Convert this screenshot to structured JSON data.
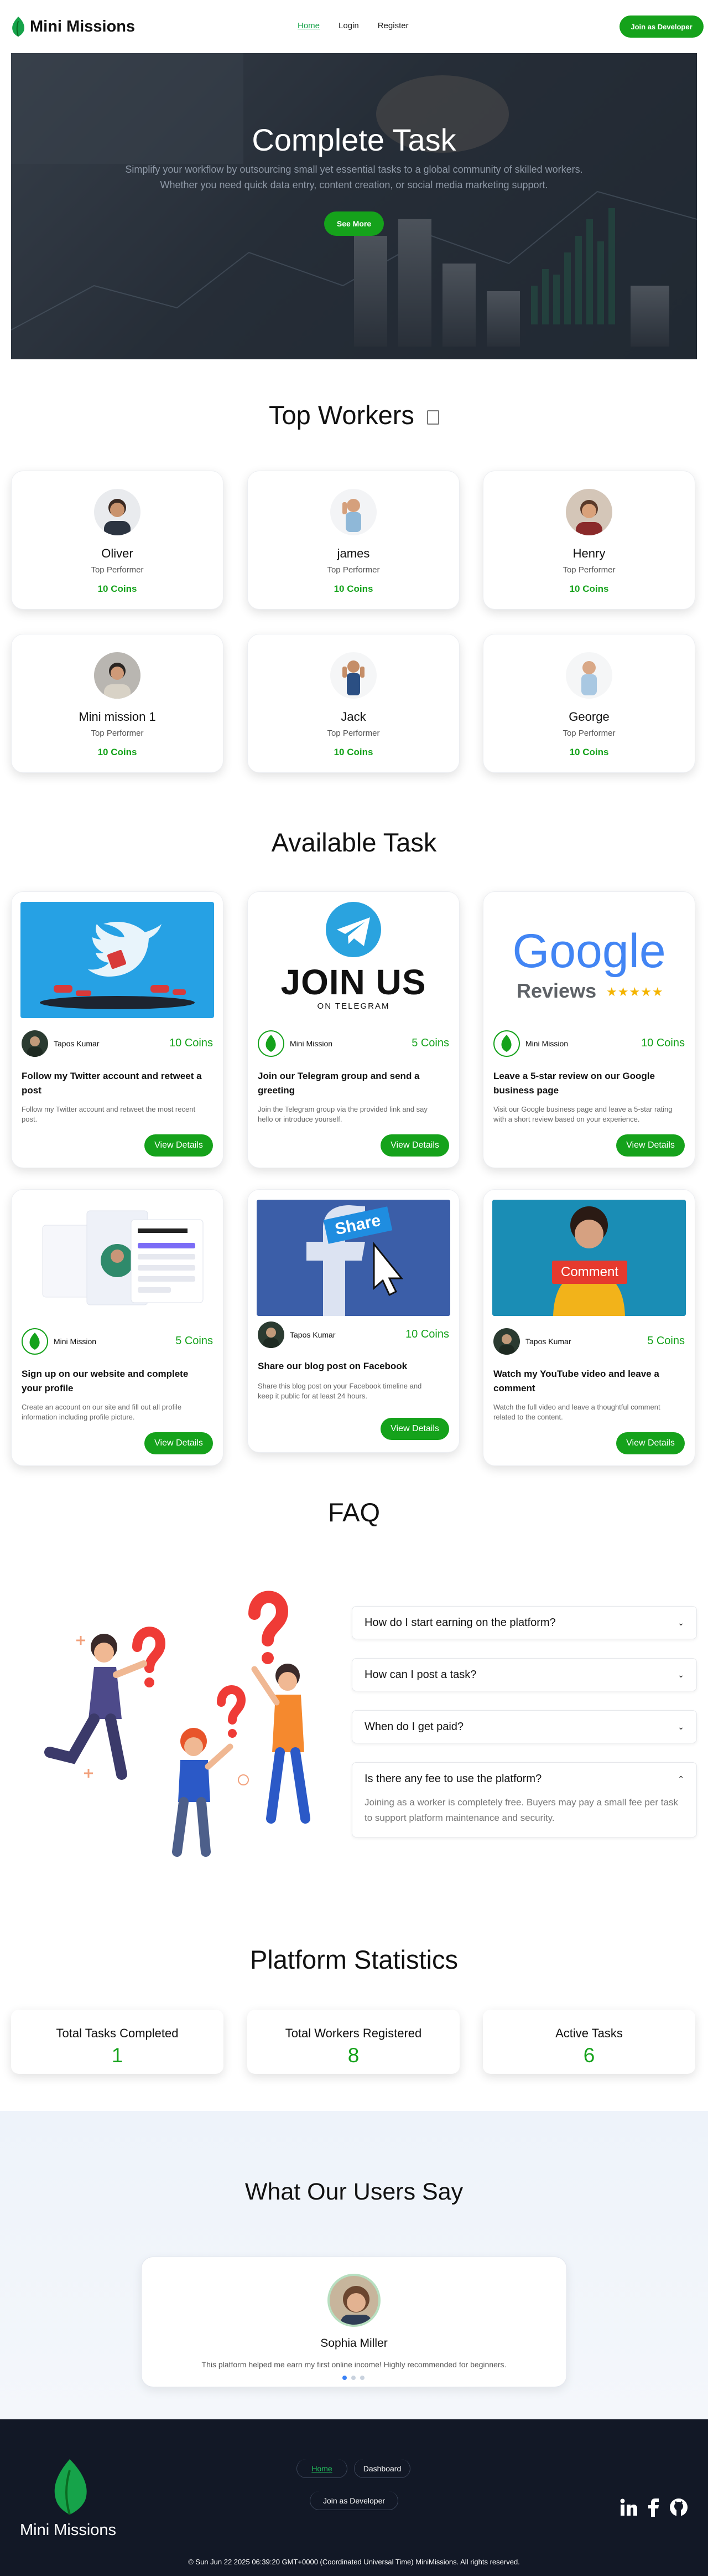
{
  "nav": {
    "brand": "Mini Missions",
    "links": [
      "Home",
      "Login",
      "Register"
    ],
    "join_button": "Join as Developer"
  },
  "hero": {
    "title": "Complete Task",
    "subtitle": "Simplify your workflow by outsourcing small yet essential tasks to a global community of skilled workers. Whether you need quick data entry, content creation, or social media marketing support.",
    "button": "See More"
  },
  "top_workers": {
    "title": "Top Workers",
    "items": [
      {
        "name": "Oliver",
        "role": "Top Performer",
        "coins": "10 Coins"
      },
      {
        "name": "james",
        "role": "Top Performer",
        "coins": "10 Coins"
      },
      {
        "name": "Henry",
        "role": "Top Performer",
        "coins": "10 Coins"
      },
      {
        "name": "Mini mission 1",
        "role": "Top Performer",
        "coins": "10 Coins"
      },
      {
        "name": "Jack",
        "role": "Top Performer",
        "coins": "10 Coins"
      },
      {
        "name": "George",
        "role": "Top Performer",
        "coins": "10 Coins"
      }
    ]
  },
  "tasks": {
    "title": "Available Task",
    "button_label": "View Details",
    "items": [
      {
        "poster": "Tapos Kumar",
        "coins": "10 Coins",
        "title": "Follow my Twitter account and retweet a post",
        "desc": "Follow my Twitter account and retweet the most recent post.",
        "image": "twitter-promo-image"
      },
      {
        "poster": "Mini Mission",
        "coins": "5 Coins",
        "title": "Join our Telegram group and send a greeting",
        "desc": "Join the Telegram group via the provided link and say hello or introduce yourself.",
        "image": "telegram-join-image",
        "image_text": "JOIN US",
        "image_sub": "ON TELEGRAM"
      },
      {
        "poster": "Mini Mission",
        "coins": "10 Coins",
        "title": "Leave a 5-star review on our Google business page",
        "desc": "Visit our Google business page and leave a 5-star rating with a short review based on your experience.",
        "image": "google-reviews-image",
        "image_text": "Google",
        "image_sub": "Reviews"
      },
      {
        "poster": "Mini Mission",
        "coins": "5 Coins",
        "title": "Sign up on our website and complete your profile",
        "desc": "Create an account on our site and fill out all profile information including profile picture.",
        "image": "profile-signup-image"
      },
      {
        "poster": "Tapos Kumar",
        "coins": "10 Coins",
        "title": "Share our blog post on Facebook",
        "desc": "Share this blog post on your Facebook timeline and keep it public for at least 24 hours.",
        "image": "facebook-share-image",
        "image_text": "Share"
      },
      {
        "poster": "Tapos Kumar",
        "coins": "5 Coins",
        "title": "Watch my YouTube video and leave a comment",
        "desc": "Watch the full video and leave a thoughtful comment related to the content.",
        "image": "youtube-comment-image",
        "image_text": "Comment"
      }
    ]
  },
  "faq": {
    "title": "FAQ",
    "items": [
      {
        "q": "How do I start earning on the platform?",
        "open": false
      },
      {
        "q": "How can I post a task?",
        "open": false
      },
      {
        "q": "When do I get paid?",
        "open": false
      },
      {
        "q": "Is there any fee to use the platform?",
        "open": true,
        "a": "Joining as a worker is completely free. Buyers may pay a small fee per task to support platform maintenance and security."
      }
    ]
  },
  "stats": {
    "title": "Platform Statistics",
    "items": [
      {
        "label": "Total Tasks Completed",
        "value": "1"
      },
      {
        "label": "Total Workers Registered",
        "value": "8"
      },
      {
        "label": "Active Tasks",
        "value": "6"
      }
    ]
  },
  "testimonials": {
    "title": "What Our Users Say",
    "name": "Sophia Miller",
    "quote": "This platform helped me earn my first online income! Highly recommended for beginners.",
    "active_dot": 0,
    "dot_count": 3
  },
  "footer": {
    "brand": "Mini Missions",
    "links": [
      "Home",
      "Dashboard"
    ],
    "join_link": "Join as Developer",
    "copyright": "© Sun Jun 22 2025 06:39:20 GMT+0000 (Coordinated Universal Time) MiniMissions. All rights reserved.",
    "social": [
      "linkedin-icon",
      "facebook-icon",
      "github-icon"
    ]
  },
  "colors": {
    "accent": "#15a21b",
    "footer_bg": "#121826",
    "hero_overlay": "#19202a"
  }
}
